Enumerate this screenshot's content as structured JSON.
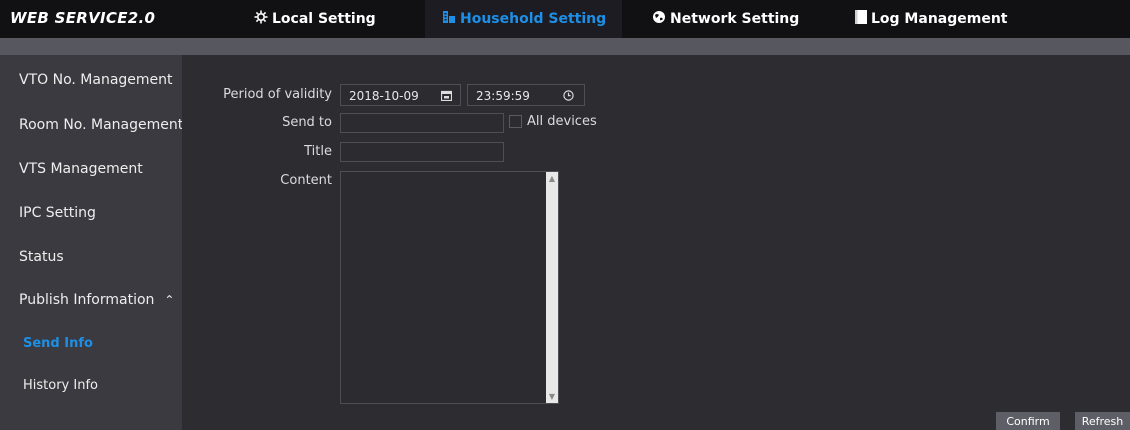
{
  "header": {
    "brand": "WEB SERVICE2.0",
    "tabs": [
      {
        "label": "Local Setting",
        "icon": "gear-icon"
      },
      {
        "label": "Household Setting",
        "icon": "building-icon"
      },
      {
        "label": "Network Setting",
        "icon": "globe-icon"
      },
      {
        "label": "Log Management",
        "icon": "document-icon"
      }
    ],
    "active_color": "#1e8fe6"
  },
  "sidebar": {
    "items": [
      {
        "label": "VTO No. Management"
      },
      {
        "label": "Room No. Management"
      },
      {
        "label": "VTS Management"
      },
      {
        "label": "IPC Setting"
      },
      {
        "label": "Status"
      },
      {
        "label": "Publish Information"
      },
      {
        "label": "Send Info"
      },
      {
        "label": "History Info"
      }
    ]
  },
  "form": {
    "validity_label": "Period of validity",
    "validity_date": "2018-10-09",
    "validity_time": "23:59:59",
    "send_to_label": "Send to",
    "send_to_value": "",
    "all_devices_label": "All devices",
    "title_label": "Title",
    "title_value": "",
    "content_label": "Content",
    "content_value": ""
  },
  "buttons": {
    "confirm": "Confirm",
    "refresh": "Refresh"
  }
}
